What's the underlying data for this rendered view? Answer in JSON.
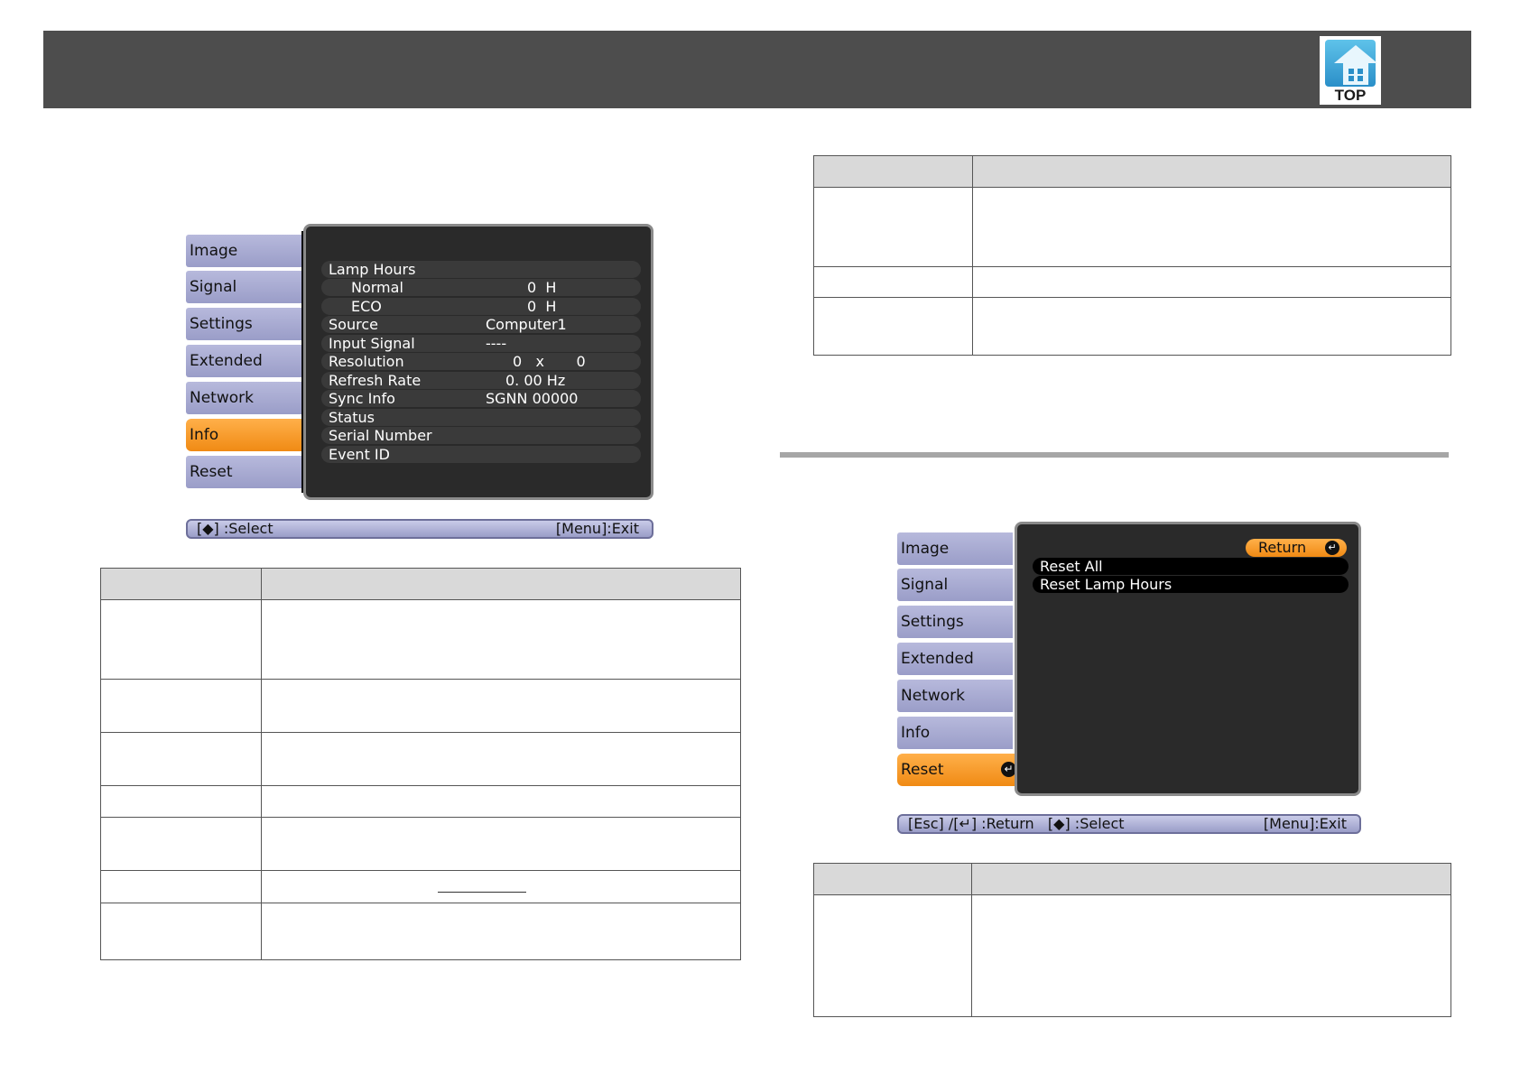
{
  "header": {
    "top_button_label": "TOP"
  },
  "info_menu": {
    "tabs": [
      "Image",
      "Signal",
      "Settings",
      "Extended",
      "Network",
      "Info",
      "Reset"
    ],
    "active_tab": "Info",
    "rows": [
      {
        "label": "Lamp Hours",
        "value": ""
      },
      {
        "label": "Normal",
        "value": "0  H"
      },
      {
        "label": "ECO",
        "value": "0  H"
      },
      {
        "label": "Source",
        "value": "Computer1"
      },
      {
        "label": "Input Signal",
        "value": "----"
      },
      {
        "label": "Resolution",
        "value": "0   x       0"
      },
      {
        "label": "Refresh Rate",
        "value": "0. 00 Hz"
      },
      {
        "label": "Sync Info",
        "value": "SGNN 00000"
      },
      {
        "label": "Status",
        "value": ""
      },
      {
        "label": "Serial Number",
        "value": ""
      },
      {
        "label": "Event ID",
        "value": ""
      }
    ],
    "status_left": "[◆] :Select",
    "status_right": "[Menu]:Exit"
  },
  "reset_menu": {
    "tabs": [
      "Image",
      "Signal",
      "Settings",
      "Extended",
      "Network",
      "Info",
      "Reset"
    ],
    "active_tab": "Reset",
    "return_label": "Return",
    "items": [
      "Reset All",
      "Reset Lamp Hours"
    ],
    "status_left": "[Esc] /[↵] :Return   [◆] :Select",
    "status_right": "[Menu]:Exit"
  },
  "colors": {
    "active_tab": "#f08a14",
    "inactive_tab": "#a9abd3",
    "panel": "#2a2a2a",
    "header": "#4d4d4d"
  }
}
